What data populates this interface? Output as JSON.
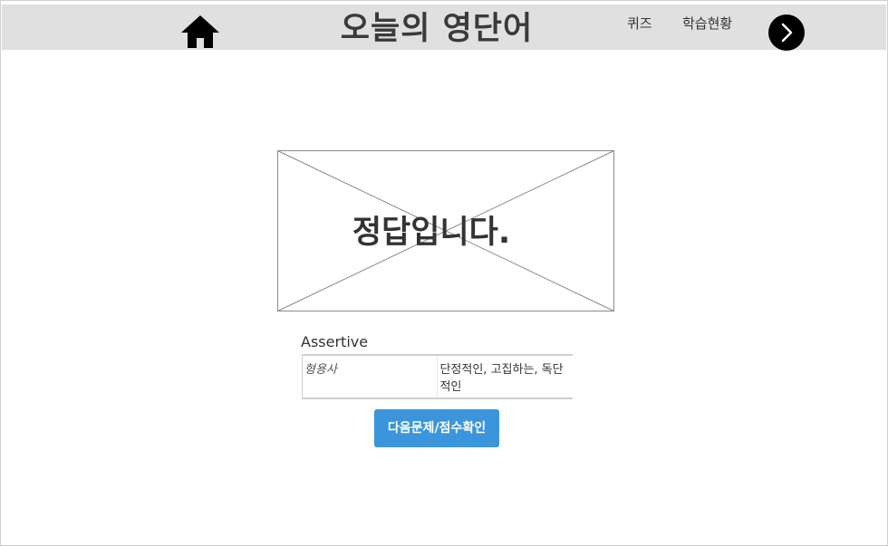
{
  "header": {
    "title": "오늘의 영단어",
    "nav": {
      "quiz_label": "퀴즈",
      "progress_label": "학습현황"
    },
    "icons": {
      "home": "home-icon",
      "next": "chevron-right-icon"
    }
  },
  "result": {
    "message": "정답입니다."
  },
  "word": {
    "term": "Assertive",
    "part_of_speech": "형용사",
    "meaning": "단정적인, 고집하는, 독단적인"
  },
  "actions": {
    "next_label": "다음문제/점수확인"
  },
  "colors": {
    "header_bg": "#e0e0e0",
    "button_bg": "#3a95dd",
    "next_circle_bg": "#000000"
  }
}
